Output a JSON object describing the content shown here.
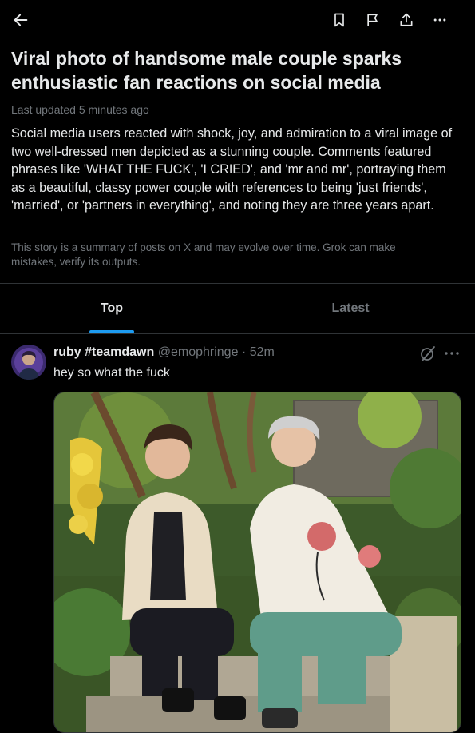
{
  "header": {
    "back_icon": "arrow-left-icon",
    "actions": [
      "bookmark-icon",
      "flag-icon",
      "share-icon",
      "more-icon"
    ]
  },
  "story": {
    "headline": "Viral photo of handsome male couple sparks enthusiastic fan reactions on social media",
    "updated": "Last updated 5 minutes ago",
    "summary": "Social media users reacted with shock, joy, and admiration to a viral image of two well-dressed men depicted as a stunning couple. Comments featured phrases like 'WHAT THE FUCK', 'I CRIED', and 'mr and mr', portraying them as a beautiful, classy power couple with references to being 'just friends', 'married', or 'partners in everything', and noting they are three years apart.",
    "disclaimer": "This story is a summary of posts on X and may evolve over time. Grok can make mistakes, verify its outputs."
  },
  "tabs": {
    "top": "Top",
    "latest": "Latest"
  },
  "post": {
    "display_name": "ruby #teamdawn",
    "handle": "@emophringe",
    "separator": "·",
    "time": "52m",
    "text": "hey so what the fuck"
  },
  "colors": {
    "accent": "#1d9bf0",
    "text": "#e7e9ea",
    "muted": "#71767b",
    "border": "#2f3336",
    "background": "#000000"
  }
}
